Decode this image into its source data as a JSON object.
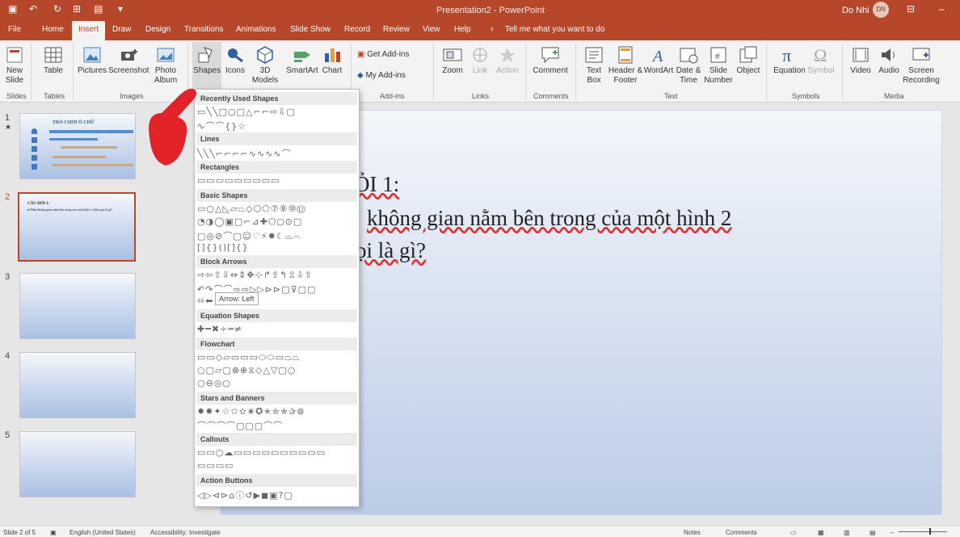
{
  "title": {
    "text": "Presentation2 - PowerPoint",
    "user": "Do Nhi",
    "avatar": "DN"
  },
  "tabs": [
    "File",
    "Home",
    "Insert",
    "Draw",
    "Design",
    "Transitions",
    "Animations",
    "Slide Show",
    "Record",
    "Review",
    "View",
    "Help"
  ],
  "tell_me": "Tell me what you want to do",
  "ribbon": {
    "buttons": {
      "new_slide": "New Slide",
      "table": "Table",
      "pictures": "Pictures",
      "screenshot": "Screenshot",
      "photo_album": "Photo Album",
      "shapes": "Shapes",
      "icons": "Icons",
      "models": "3D Models",
      "smartart": "SmartArt",
      "chart": "Chart",
      "get_addins": "Get Add-ins",
      "my_addins": "My Add-ins",
      "zoom": "Zoom",
      "link": "Link",
      "action": "Action",
      "comment": "Comment",
      "text_box": "Text Box",
      "header_footer": "Header & Footer",
      "wordart": "WordArt",
      "date_time": "Date & Time",
      "slide_number": "Slide Number",
      "object": "Object",
      "equation": "Equation",
      "symbol": "Symbol",
      "video": "Video",
      "audio": "Audio",
      "screen_recording": "Screen Recording"
    },
    "groups": {
      "slides": "Slides",
      "tables": "Tables",
      "images": "Images",
      "addins": "Add-ins",
      "links": "Links",
      "comments": "Comments",
      "text": "Text",
      "symbols": "Symbols",
      "media": "Media"
    }
  },
  "thumbnails": [
    {
      "num": "1",
      "title": "TRÒ CHƠI Ô CHỮ"
    },
    {
      "num": "2",
      "title": "CÂU HỎI 1:",
      "body": "● Phần không gian nằm bên trong của một hình 2 chiều gọi là gì?"
    },
    {
      "num": "3"
    },
    {
      "num": "4"
    },
    {
      "num": "5"
    }
  ],
  "slide": {
    "line1": "ỎI 1:",
    "line2": "không gian nằm bên trong của một hình 2",
    "line3": "ọi là gì?"
  },
  "shapes_menu": {
    "categories": [
      "Recently Used Shapes",
      "Lines",
      "Rectangles",
      "Basic Shapes",
      "Block Arrows",
      "Equation Shapes",
      "Flowchart",
      "Stars and Banners",
      "Callouts",
      "Action Buttons"
    ],
    "tooltip": "Arrow: Left"
  },
  "status": {
    "slide": "Slide 2 of 5",
    "language": "English (United States)",
    "accessibility": "Accessibility: Investigate",
    "notes": "Notes",
    "comments": "Comments"
  },
  "colors": {
    "accent": "#b7472a"
  }
}
